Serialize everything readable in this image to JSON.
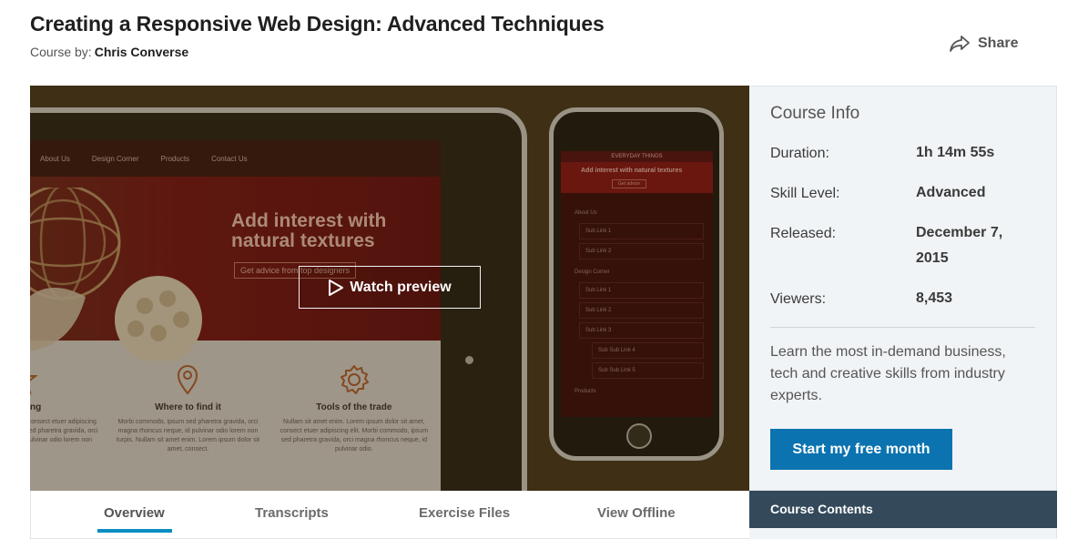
{
  "course": {
    "title": "Creating a Responsive Web Design: Advanced Techniques",
    "by_label": "Course by:",
    "author": "Chris Converse"
  },
  "share": {
    "label": "Share",
    "icon": "share-arrow-icon"
  },
  "video": {
    "watch_label": "Watch preview",
    "play_icon": "play-icon",
    "preview": {
      "nav": [
        "About Us",
        "Design Corner",
        "Products",
        "Contact Us"
      ],
      "headline": "Add interest with natural textures",
      "cta": "Get advice from top designers",
      "features": [
        {
          "icon": "star-icon",
          "name": "Trending",
          "text": "Lorem ipsum dolor sit amet, consect etuer adipiscing elit. Morbi commodo, ipsum sed pharetra gravida, orci magna rhoncus neque, id pulvinar odio lorem non turpis."
        },
        {
          "icon": "map-pin-icon",
          "name": "Where to find it",
          "text": "Morbi commodo, ipsum sed pharetra gravida, orci magna rhoncus neque, id pulvinar odio lorem non turpis. Nullam sit amet enim. Lorem ipsum dolor sit amet, consect."
        },
        {
          "icon": "gear-icon",
          "name": "Tools of the trade",
          "text": "Nullam sit amet enim. Lorem ipsum dolor sit amet, consect etuer adipiscing elit. Morbi commodo, ipsum sed pharetra gravida, orci magna rhoncus neque, id pulvinar odio."
        }
      ],
      "phone": {
        "top": "EVERYDAY THINGS",
        "headline": "Add interest with natural textures",
        "button": "Get advice",
        "menu": [
          {
            "label": "About Us",
            "level": 0
          },
          {
            "label": "Sub Link 1",
            "level": 1
          },
          {
            "label": "Sub Link 2",
            "level": 1
          },
          {
            "label": "Design Corner",
            "level": 0
          },
          {
            "label": "Sub Link 1",
            "level": 1
          },
          {
            "label": "Sub Link 2",
            "level": 1
          },
          {
            "label": "Sub Link 3",
            "level": 1
          },
          {
            "label": "Sub Sub Link 4",
            "level": 2
          },
          {
            "label": "Sub Sub Link 5",
            "level": 2
          },
          {
            "label": "Products",
            "level": 0
          }
        ]
      }
    }
  },
  "tabs": [
    {
      "label": "Overview",
      "active": true
    },
    {
      "label": "Transcripts",
      "active": false
    },
    {
      "label": "Exercise Files",
      "active": false
    },
    {
      "label": "View Offline",
      "active": false
    }
  ],
  "course_info": {
    "heading": "Course Info",
    "rows": [
      {
        "label": "Duration:",
        "value": "1h 14m 55s"
      },
      {
        "label": "Skill Level:",
        "value": "Advanced"
      },
      {
        "label": "Released:",
        "value": "December 7, 2015"
      },
      {
        "label": "Viewers:",
        "value": "8,453"
      }
    ],
    "pitch": "Learn the most in-demand business, tech and creative skills from industry experts.",
    "cta": "Start my free month"
  },
  "course_contents": {
    "label": "Course Contents"
  },
  "colors": {
    "accent": "#0a8ec2",
    "cta": "#0a73b0",
    "contents_bar": "#34495a",
    "sidebar_bg": "#f1f4f6"
  }
}
